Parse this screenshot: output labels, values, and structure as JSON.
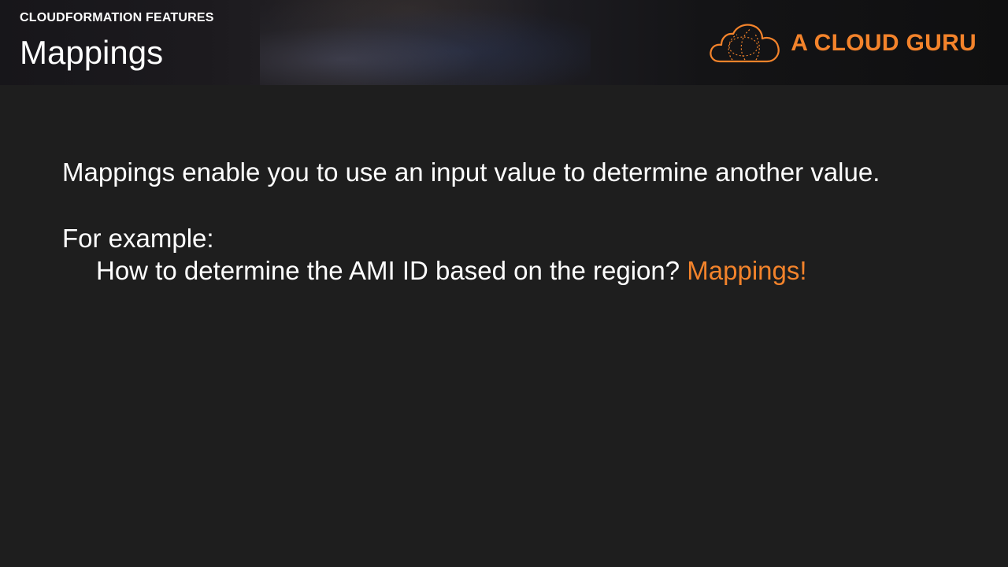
{
  "header": {
    "section_label": "CLOUDFORMATION FEATURES",
    "title": "Mappings"
  },
  "brand": {
    "name": "A CLOUD GURU",
    "logo_icon": "cloud-icon",
    "color": "#f3832b"
  },
  "content": {
    "line1": "Mappings enable you to use an input value to determine another value.",
    "line2": "For example:",
    "line3_text": "How to determine the AMI ID based on the region?",
    "line3_highlight": "Mappings!"
  },
  "colors": {
    "background": "#1e1e1e",
    "text": "#ffffff",
    "accent": "#f3832b"
  }
}
